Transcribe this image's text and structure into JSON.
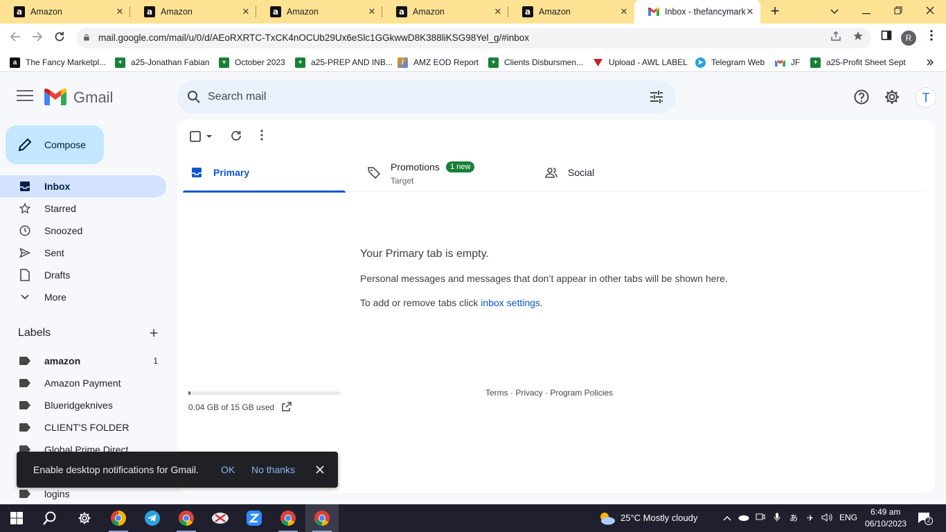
{
  "browser": {
    "tabs": [
      {
        "title": "Amazon"
      },
      {
        "title": "Amazon"
      },
      {
        "title": "Amazon"
      },
      {
        "title": "Amazon"
      },
      {
        "title": "Amazon"
      },
      {
        "title": "Inbox - thefancymark"
      }
    ],
    "tab_close_glyph": "✕",
    "new_tab_glyph": "+",
    "url": "mail.google.com/mail/u/0/d/AEoRXRTC-TxCK4nOCUb29Ux6eSlc1GGkwwD8K388liKSG98Yel_g/#inbox",
    "profile_initial": "R",
    "bookmarks": [
      {
        "label": "The Fancy Marketpl...",
        "icon": "amazon-icon",
        "color": "#111111"
      },
      {
        "label": "a25-Jonathan Fabian",
        "icon": "sheets-icon",
        "color": "#188038"
      },
      {
        "label": "October 2023",
        "icon": "sheets-icon",
        "color": "#188038"
      },
      {
        "label": "a25-PREP AND INB...",
        "icon": "sheets-icon",
        "color": "#188038"
      },
      {
        "label": "AMZ EOD Report",
        "icon": "report-icon",
        "color": "#f29900"
      },
      {
        "label": "Clients Disbursmen...",
        "icon": "sheets-icon",
        "color": "#188038"
      },
      {
        "label": "Upload - AWL LABEL",
        "icon": "upload-icon",
        "color": "#c5221f"
      },
      {
        "label": "Telegram Web",
        "icon": "telegram-icon",
        "color": "#2aa3df"
      },
      {
        "label": "JF",
        "icon": "gmail-icon",
        "color": "#ea4335"
      },
      {
        "label": "a25-Profit Sheet Sept",
        "icon": "sheets-icon",
        "color": "#188038"
      }
    ]
  },
  "gmail": {
    "brand": "Gmail",
    "search_placeholder": "Search mail",
    "avatar_initial": "T",
    "compose_label": "Compose",
    "nav": [
      {
        "label": "Inbox",
        "icon": "inbox-icon",
        "active": true
      },
      {
        "label": "Starred",
        "icon": "star-icon"
      },
      {
        "label": "Snoozed",
        "icon": "clock-icon"
      },
      {
        "label": "Sent",
        "icon": "send-icon"
      },
      {
        "label": "Drafts",
        "icon": "draft-icon"
      },
      {
        "label": "More",
        "icon": "chevron-down-icon"
      }
    ],
    "labels_heading": "Labels",
    "labels": [
      {
        "name": "amazon",
        "count": "1",
        "bold": true
      },
      {
        "name": "Amazon Payment",
        "count": ""
      },
      {
        "name": "Blueridgeknives",
        "count": ""
      },
      {
        "name": "CLIENT'S FOLDER",
        "count": ""
      },
      {
        "name": "Global Prime Direct",
        "count": ""
      },
      {
        "name": "logins",
        "count": ""
      }
    ],
    "inbox_tabs": {
      "primary": "Primary",
      "promotions": "Promotions",
      "promotions_badge": "1 new",
      "promotions_sub": "Target",
      "social": "Social"
    },
    "empty": {
      "title": "Your Primary tab is empty.",
      "line1": "Personal messages and messages that don’t appear in other tabs will be shown here.",
      "line2_prefix": "To add or remove tabs click ",
      "line2_link": "inbox settings",
      "line2_suffix": "."
    },
    "storage": {
      "text": "0.04 GB of 15 GB used",
      "fraction": 0.003
    },
    "footer": "Terms · Privacy · Program Policies",
    "snackbar": {
      "text": "Enable desktop notifications for Gmail.",
      "ok": "OK",
      "no": "No thanks"
    }
  },
  "taskbar": {
    "weather": "25°C  Mostly cloudy",
    "lang": "ENG",
    "time": "6:49 am",
    "date": "06/10/2023",
    "notifications": "2"
  }
}
